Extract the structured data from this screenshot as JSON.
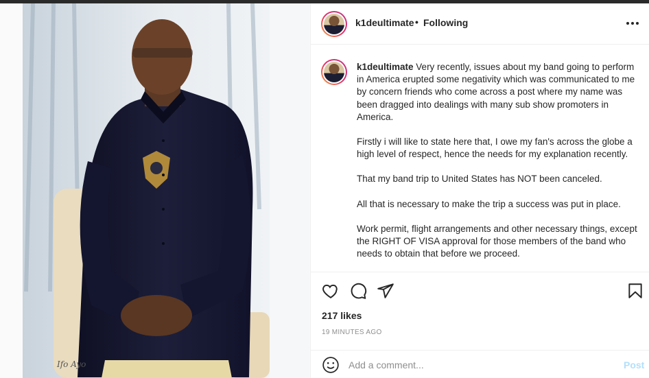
{
  "post": {
    "username": "k1deultimate",
    "separator": "•",
    "follow_status": "Following",
    "caption_paragraphs": [
      "Very recently, issues about my band going to perform in America erupted some negativity which was communicated to me by concern friends who come across a post where my name was been dragged into dealings with many sub show promoters in America.",
      "Firstly i will like to state here that, I owe my fan's across the globe a high level of respect, hence the needs for my explanation recently.",
      "That my band trip to United States has NOT been canceled.",
      "All that is necessary to make the trip a success was put in place.",
      "Work permit, flight arrangements and other necessary things, except the RIGHT OF VISA approval for those members of the band who needs to obtain that before we proceed."
    ],
    "likes": "217 likes",
    "time_ago": "19 MINUTES AGO"
  },
  "comment": {
    "placeholder": "Add a comment...",
    "post_label": "Post"
  },
  "icons": {
    "more": "more-horizontal-icon",
    "like": "heart-icon",
    "comment": "comment-bubble-icon",
    "share": "paper-plane-icon",
    "save": "bookmark-icon",
    "emoji": "smiley-icon"
  },
  "photo": {
    "watermark": "Ifo Ayo"
  },
  "colors": {
    "post_button": "#b2dffc",
    "muted": "#8e8e8e",
    "text": "#262626"
  }
}
